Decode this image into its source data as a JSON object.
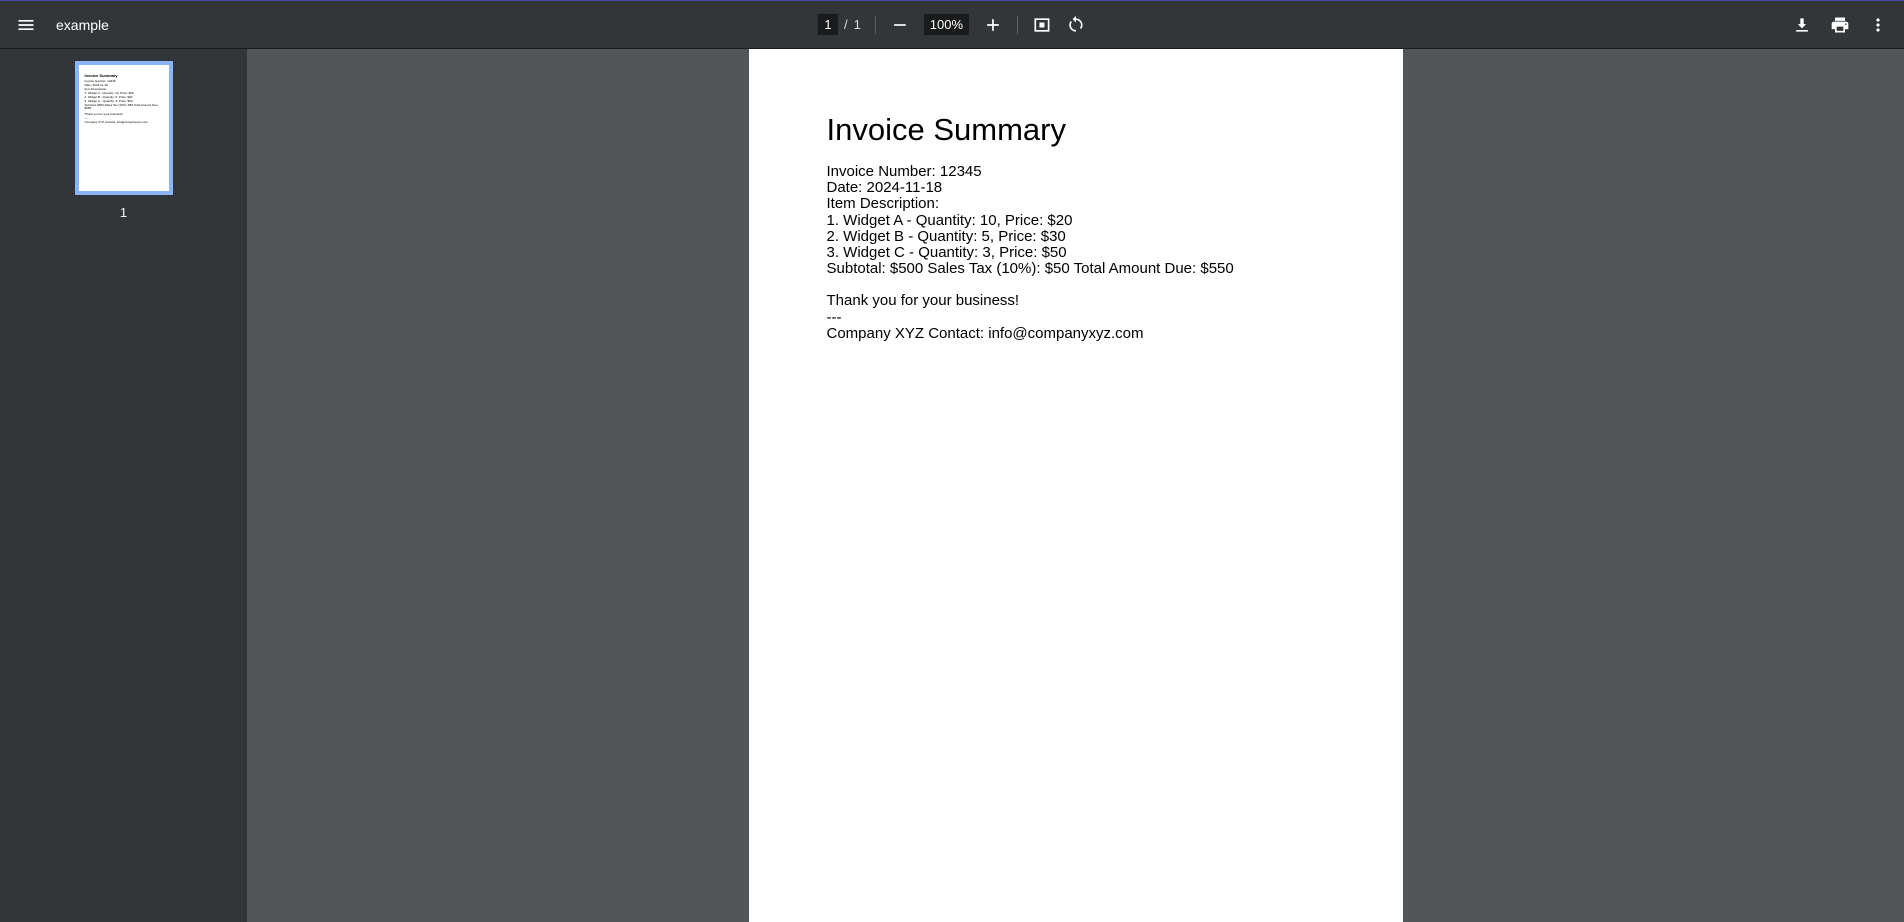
{
  "toolbar": {
    "title": "example",
    "current_page": "1",
    "page_separator": "/",
    "total_pages": "1",
    "zoom": "100%"
  },
  "sidebar": {
    "thumbnail_label": "1"
  },
  "document": {
    "title": "Invoice Summary",
    "line1": "Invoice Number: 12345",
    "line2": "Date: 2024-11-18",
    "line3": "Item Description:",
    "line4": "1. Widget A - Quantity: 10, Price: $20",
    "line5": "2. Widget B - Quantity: 5, Price: $30",
    "line6": "3. Widget C - Quantity: 3, Price: $50",
    "line7": "Subtotal: $500 Sales Tax (10%): $50 Total Amount Due: $550",
    "thanks": "Thank you for your business!",
    "dashes": " ---",
    "contact": "Company XYZ Contact: info@companyxyz.com"
  }
}
